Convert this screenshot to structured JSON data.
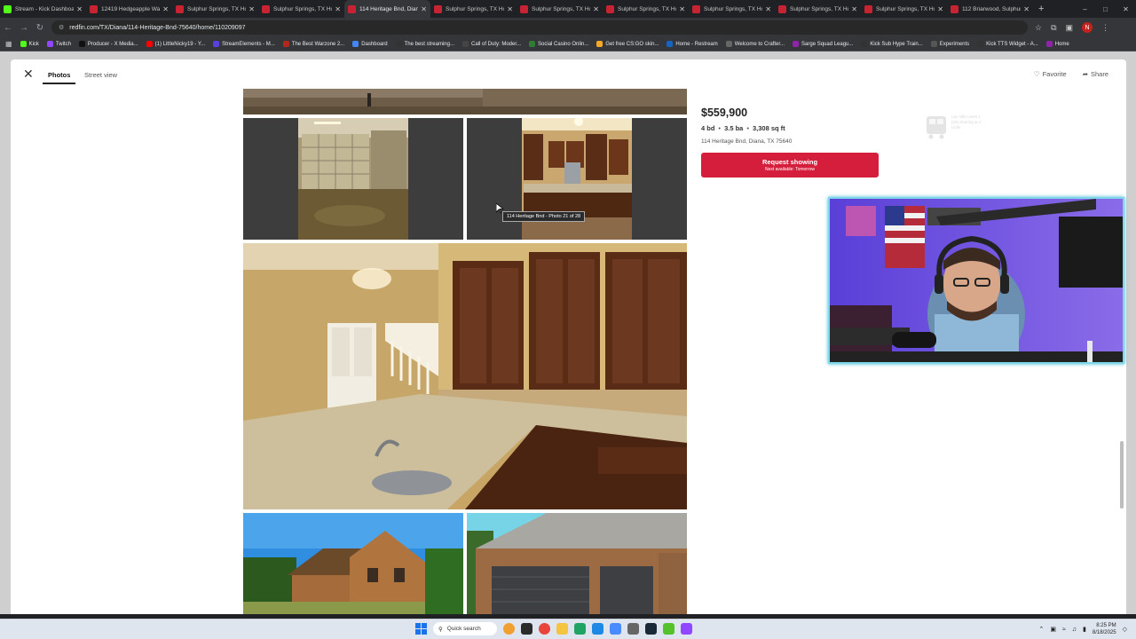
{
  "tabs": [
    {
      "title": "Stream - Kick Dashboard",
      "color": "#53fc18"
    },
    {
      "title": "12419 Hedgeapple Wa...",
      "color": "#c82333"
    },
    {
      "title": "Sulphur Springs, TX Ho...",
      "color": "#c82333"
    },
    {
      "title": "Sulphur Springs, TX Ho...",
      "color": "#c82333"
    },
    {
      "title": "114 Heritage Bnd, Diana...",
      "color": "#c82333"
    },
    {
      "title": "Sulphur Springs, TX Ho...",
      "color": "#c82333"
    },
    {
      "title": "Sulphur Springs, TX Ho...",
      "color": "#c82333"
    },
    {
      "title": "Sulphur Springs, TX Ho...",
      "color": "#c82333"
    },
    {
      "title": "Sulphur Springs, TX Ho...",
      "color": "#c82333"
    },
    {
      "title": "Sulphur Springs, TX Ho...",
      "color": "#c82333"
    },
    {
      "title": "Sulphur Springs, TX Ho...",
      "color": "#c82333"
    },
    {
      "title": "112 Briarwood, Sulphur...",
      "color": "#c82333"
    }
  ],
  "address_bar": {
    "url": "redfin.com/TX/Diana/114-Heritage-Bnd-75640/home/110209097",
    "profile_initial": "N"
  },
  "bookmarks": [
    {
      "label": "Kick",
      "color": "#53fc18"
    },
    {
      "label": "Twitch",
      "color": "#9146ff"
    },
    {
      "label": "Producer - X Media...",
      "color": "#111111"
    },
    {
      "label": "(1) LittleNicky19 - Y...",
      "color": "#ff0000"
    },
    {
      "label": "StreamElements - M...",
      "color": "#5a3fe0"
    },
    {
      "label": "The Best Warzone 2...",
      "color": "#b3261e"
    },
    {
      "label": "Dashboard",
      "color": "#4285f4"
    },
    {
      "label": "The best streaming...",
      "color": "#333333"
    },
    {
      "label": "Call of Duty: Moder...",
      "color": "#444444"
    },
    {
      "label": "Social Casino Onlin...",
      "color": "#2e7d32"
    },
    {
      "label": "Get free CS:GO skin...",
      "color": "#f9a825"
    },
    {
      "label": "Home - Restream",
      "color": "#1565c0"
    },
    {
      "label": "Welcome to Crafter...",
      "color": "#666666"
    },
    {
      "label": "Sarge Squad Leagu...",
      "color": "#8e24aa"
    },
    {
      "label": "Kick Sub Hype Train...",
      "color": "#333333"
    },
    {
      "label": "Experiments",
      "color": "#555555"
    },
    {
      "label": "Kick TTS Widget - A...",
      "color": "#333333"
    },
    {
      "label": "Home",
      "color": "#8e24aa"
    }
  ],
  "modal": {
    "tabs": {
      "photos": "Photos",
      "street_view": "Street view"
    },
    "favorite": "Favorite",
    "share": "Share"
  },
  "listing": {
    "price": "$559,900",
    "beds": "4 bd",
    "baths": "3.5 ba",
    "sqft": "3,308 sq ft",
    "address": "114 Heritage Bnd, Diana, TX 75640",
    "request_button": "Request showing",
    "request_sub": "Next available: Tomorrow",
    "watermark_text": "Lax Ville Level 1 (20) Sharing at 4 Units"
  },
  "photo_tooltip": "114 Heritage Bnd - Photo 21 of 28",
  "taskbar": {
    "search": "Quick search",
    "time": "8:25 PM",
    "date": "8/18/2025"
  }
}
